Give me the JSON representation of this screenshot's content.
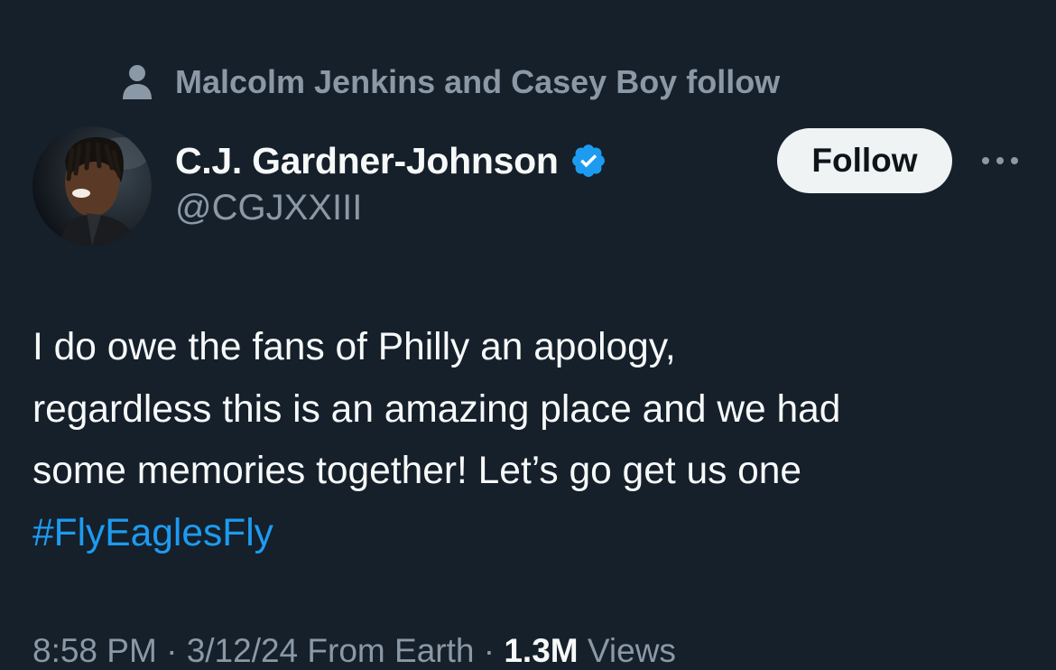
{
  "social_context": {
    "text": "Malcolm Jenkins and Casey Boy follow",
    "icon": "person-icon"
  },
  "author": {
    "display_name": "C.J. Gardner-Johnson",
    "handle": "@CGJXXIII",
    "verified_icon": "verified-badge-icon",
    "verified_color": "#1d9bf0"
  },
  "actions": {
    "follow_label": "Follow",
    "more_icon": "more-horizontal-icon"
  },
  "tweet": {
    "lines": [
      "I do owe the fans of Philly an apology,",
      "regardless this is an amazing place and we had",
      "some memories together! Let’s go get us one"
    ],
    "hashtag": "#FlyEaglesFly",
    "hashtag_color": "#1d9bf0"
  },
  "meta": {
    "time": "8:58 PM",
    "separator": "·",
    "date": "3/12/24",
    "source": "From Earth",
    "views_count": "1.3M",
    "views_label": "Views"
  },
  "colors": {
    "background": "#15202b",
    "text_primary": "#f7f9f9",
    "text_secondary": "#8b98a5"
  }
}
